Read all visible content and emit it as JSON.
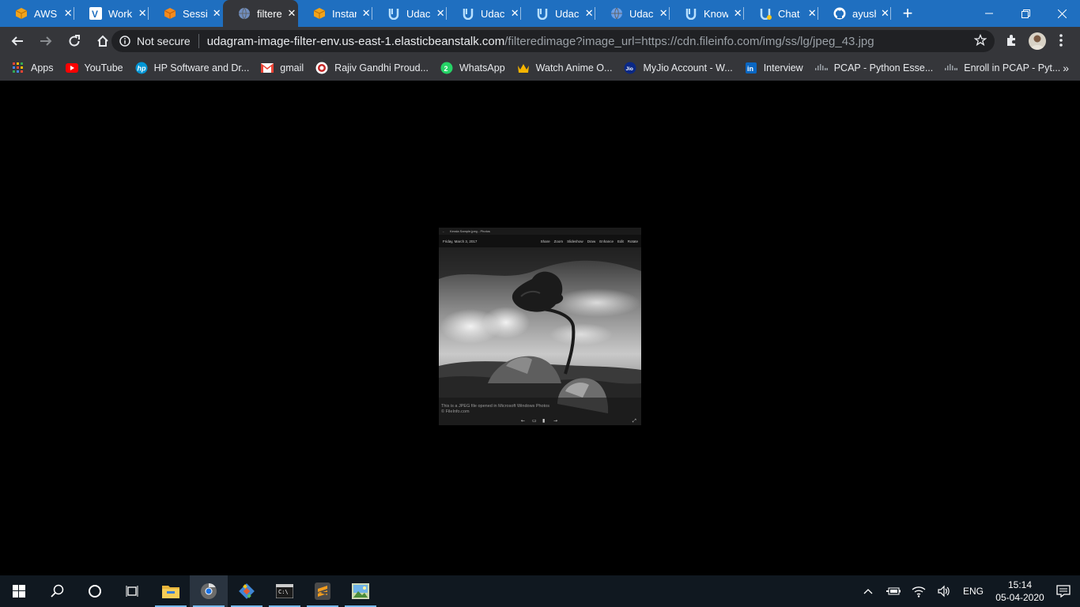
{
  "browser": {
    "tabs": [
      {
        "label": "AWS /",
        "icon": "aws-box-icon"
      },
      {
        "label": "Workl",
        "icon": "v-icon"
      },
      {
        "label": "Sessic",
        "icon": "aws-cube-icon"
      },
      {
        "label": "filtere",
        "icon": "globe-icon",
        "active": true
      },
      {
        "label": "Instan",
        "icon": "aws-box-icon"
      },
      {
        "label": "Udaci",
        "icon": "udacity-icon"
      },
      {
        "label": "Udaci",
        "icon": "udacity-icon"
      },
      {
        "label": "Udaci",
        "icon": "udacity-icon"
      },
      {
        "label": "Udaci",
        "icon": "globe-icon"
      },
      {
        "label": "Know",
        "icon": "udacity-icon"
      },
      {
        "label": "Chat",
        "icon": "udacity-chat-icon"
      },
      {
        "label": "ayush",
        "icon": "github-icon"
      }
    ],
    "close_glyph": "✕",
    "new_tab_glyph": "+",
    "security_label": "Not secure",
    "url_host": "udagram-image-filter-env.us-east-1.elasticbeanstalk.com",
    "url_rest": "/filteredimage?image_url=https://cdn.fileinfo.com/img/ss/lg/jpeg_43.jpg",
    "bookmarks": [
      {
        "label": "Apps",
        "icon": "apps-grid-icon"
      },
      {
        "label": "YouTube",
        "icon": "youtube-icon"
      },
      {
        "label": "HP Software and Dr...",
        "icon": "hp-icon"
      },
      {
        "label": "gmail",
        "icon": "gmail-icon"
      },
      {
        "label": "Rajiv Gandhi Proud...",
        "icon": "rgpv-icon"
      },
      {
        "label": "WhatsApp",
        "icon": "whatsapp-icon"
      },
      {
        "label": "Watch Anime O...",
        "icon": "crown-icon"
      },
      {
        "label": "MyJio Account - W...",
        "icon": "jio-icon"
      },
      {
        "label": "Interview",
        "icon": "linkedin-icon"
      },
      {
        "label": "PCAP - Python Esse...",
        "icon": "cisco-icon"
      },
      {
        "label": "Enroll in PCAP - Pyt...",
        "icon": "cisco-icon"
      }
    ],
    "bookmarks_more": "»"
  },
  "photo": {
    "window_title": "Kerala Sample.jpeg - Photos",
    "date": "Friday, March 3, 2017",
    "commands": [
      "Share",
      "Zoom",
      "Slideshow",
      "Draw",
      "Enhance",
      "Edit",
      "Rotate"
    ],
    "caption_line1": "This is a JPEG file opened in Microsoft Windows Photos",
    "caption_line2": "© FileInfo.com"
  },
  "taskbar": {
    "apps": [
      {
        "name": "file-explorer-icon"
      },
      {
        "name": "chrome-dev-icon",
        "active": true
      },
      {
        "name": "git-icon"
      },
      {
        "name": "terminal-icon"
      },
      {
        "name": "sublime-text-icon"
      },
      {
        "name": "photos-icon"
      }
    ],
    "language": "ENG",
    "time": "15:14",
    "date": "05-04-2020"
  }
}
